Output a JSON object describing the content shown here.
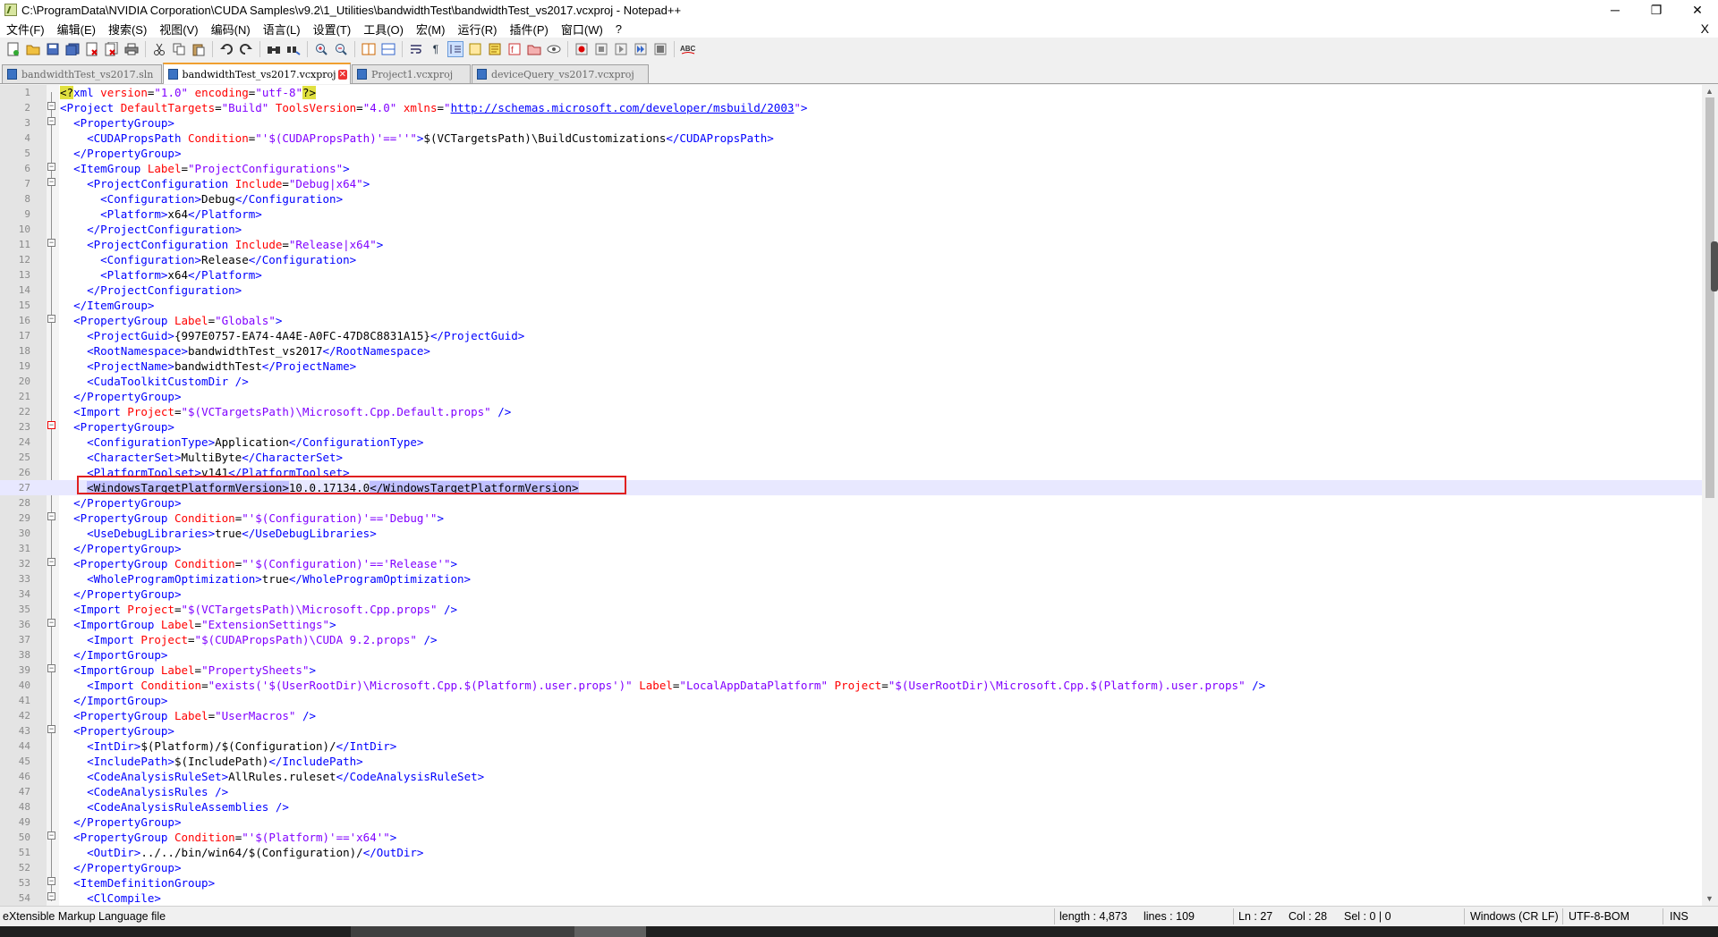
{
  "window": {
    "title": "C:\\ProgramData\\NVIDIA Corporation\\CUDA Samples\\v9.2\\1_Utilities\\bandwidthTest\\bandwidthTest_vs2017.vcxproj - Notepad++",
    "minimize": "─",
    "restore": "❐",
    "close": "✕"
  },
  "menu": {
    "items": [
      "文件(F)",
      "编辑(E)",
      "搜索(S)",
      "视图(V)",
      "编码(N)",
      "语言(L)",
      "设置(T)",
      "工具(O)",
      "宏(M)",
      "运行(R)",
      "插件(P)",
      "窗口(W)",
      "?"
    ],
    "close_doc": "X"
  },
  "toolbar": {
    "icons": [
      "new-file-icon",
      "open-file-icon",
      "save-icon",
      "save-all-icon",
      "close-icon",
      "close-all-icon",
      "print-icon",
      "cut-icon",
      "copy-icon",
      "paste-icon",
      "undo-icon",
      "redo-icon",
      "find-icon",
      "replace-icon",
      "zoom-in-icon",
      "zoom-out-icon",
      "sync-v-icon",
      "sync-h-icon",
      "word-wrap-icon",
      "show-all-chars-icon",
      "indent-guide-icon",
      "udl-icon",
      "doc-map-icon",
      "function-list-icon",
      "folder-workspace-icon",
      "monitor-icon",
      "record-macro-icon",
      "stop-record-icon",
      "play-macro-icon",
      "run-multiple-icon",
      "save-macro-icon",
      "spellcheck-icon"
    ]
  },
  "tabs": [
    {
      "label": "bandwidthTest_vs2017.sln",
      "active": false
    },
    {
      "label": "bandwidthTest_vs2017.vcxproj",
      "active": true
    },
    {
      "label": "Project1.vcxproj",
      "active": false
    },
    {
      "label": "deviceQuery_vs2017.vcxproj",
      "active": false
    }
  ],
  "editor": {
    "caret_line": 27,
    "lines": [
      [
        [
          "hlm",
          "<?"
        ],
        [
          "t",
          "xml "
        ],
        [
          "a",
          "version"
        ],
        [
          "p",
          "="
        ],
        [
          "v",
          "\"1.0\""
        ],
        [
          "p",
          " "
        ],
        [
          "a",
          "encoding"
        ],
        [
          "p",
          "="
        ],
        [
          "v",
          "\"utf-8\""
        ],
        [
          "hlm",
          "?>"
        ]
      ],
      [
        [
          "t",
          "<Project "
        ],
        [
          "a",
          "DefaultTargets"
        ],
        [
          "p",
          "="
        ],
        [
          "v",
          "\"Build\""
        ],
        [
          "p",
          " "
        ],
        [
          "a",
          "ToolsVersion"
        ],
        [
          "p",
          "="
        ],
        [
          "v",
          "\"4.0\""
        ],
        [
          "p",
          " "
        ],
        [
          "a",
          "xmlns"
        ],
        [
          "p",
          "="
        ],
        [
          "v",
          "\""
        ],
        [
          "u",
          "http://schemas.microsoft.com/developer/msbuild/2003"
        ],
        [
          "v",
          "\""
        ],
        [
          "t",
          ">"
        ]
      ],
      [
        [
          "p",
          "  "
        ],
        [
          "t",
          "<PropertyGroup>"
        ]
      ],
      [
        [
          "p",
          "    "
        ],
        [
          "t",
          "<CUDAPropsPath "
        ],
        [
          "a",
          "Condition"
        ],
        [
          "p",
          "="
        ],
        [
          "v",
          "\"'$(CUDAPropsPath)'==''\""
        ],
        [
          "t",
          ">"
        ],
        [
          "p",
          "$(VCTargetsPath)\\BuildCustomizations"
        ],
        [
          "t",
          "</CUDAPropsPath>"
        ]
      ],
      [
        [
          "p",
          "  "
        ],
        [
          "t",
          "</PropertyGroup>"
        ]
      ],
      [
        [
          "p",
          "  "
        ],
        [
          "t",
          "<ItemGroup "
        ],
        [
          "a",
          "Label"
        ],
        [
          "p",
          "="
        ],
        [
          "v",
          "\"ProjectConfigurations\""
        ],
        [
          "t",
          ">"
        ]
      ],
      [
        [
          "p",
          "    "
        ],
        [
          "t",
          "<ProjectConfiguration "
        ],
        [
          "a",
          "Include"
        ],
        [
          "p",
          "="
        ],
        [
          "v",
          "\"Debug|x64\""
        ],
        [
          "t",
          ">"
        ]
      ],
      [
        [
          "p",
          "      "
        ],
        [
          "t",
          "<Configuration>"
        ],
        [
          "p",
          "Debug"
        ],
        [
          "t",
          "</Configuration>"
        ]
      ],
      [
        [
          "p",
          "      "
        ],
        [
          "t",
          "<Platform>"
        ],
        [
          "p",
          "x64"
        ],
        [
          "t",
          "</Platform>"
        ]
      ],
      [
        [
          "p",
          "    "
        ],
        [
          "t",
          "</ProjectConfiguration>"
        ]
      ],
      [
        [
          "p",
          "    "
        ],
        [
          "t",
          "<ProjectConfiguration "
        ],
        [
          "a",
          "Include"
        ],
        [
          "p",
          "="
        ],
        [
          "v",
          "\"Release|x64\""
        ],
        [
          "t",
          ">"
        ]
      ],
      [
        [
          "p",
          "      "
        ],
        [
          "t",
          "<Configuration>"
        ],
        [
          "p",
          "Release"
        ],
        [
          "t",
          "</Configuration>"
        ]
      ],
      [
        [
          "p",
          "      "
        ],
        [
          "t",
          "<Platform>"
        ],
        [
          "p",
          "x64"
        ],
        [
          "t",
          "</Platform>"
        ]
      ],
      [
        [
          "p",
          "    "
        ],
        [
          "t",
          "</ProjectConfiguration>"
        ]
      ],
      [
        [
          "p",
          "  "
        ],
        [
          "t",
          "</ItemGroup>"
        ]
      ],
      [
        [
          "p",
          "  "
        ],
        [
          "t",
          "<PropertyGroup "
        ],
        [
          "a",
          "Label"
        ],
        [
          "p",
          "="
        ],
        [
          "v",
          "\"Globals\""
        ],
        [
          "t",
          ">"
        ]
      ],
      [
        [
          "p",
          "    "
        ],
        [
          "t",
          "<ProjectGuid>"
        ],
        [
          "p",
          "{997E0757-EA74-4A4E-A0FC-47D8C8831A15}"
        ],
        [
          "t",
          "</ProjectGuid>"
        ]
      ],
      [
        [
          "p",
          "    "
        ],
        [
          "t",
          "<RootNamespace>"
        ],
        [
          "p",
          "bandwidthTest_vs2017"
        ],
        [
          "t",
          "</RootNamespace>"
        ]
      ],
      [
        [
          "p",
          "    "
        ],
        [
          "t",
          "<ProjectName>"
        ],
        [
          "p",
          "bandwidthTest"
        ],
        [
          "t",
          "</ProjectName>"
        ]
      ],
      [
        [
          "p",
          "    "
        ],
        [
          "t",
          "<CudaToolkitCustomDir />"
        ]
      ],
      [
        [
          "p",
          "  "
        ],
        [
          "t",
          "</PropertyGroup>"
        ]
      ],
      [
        [
          "p",
          "  "
        ],
        [
          "t",
          "<Import "
        ],
        [
          "a",
          "Project"
        ],
        [
          "p",
          "="
        ],
        [
          "v",
          "\"$(VCTargetsPath)\\Microsoft.Cpp.Default.props\""
        ],
        [
          "p",
          " "
        ],
        [
          "t",
          "/>"
        ]
      ],
      [
        [
          "p",
          "  "
        ],
        [
          "t",
          "<PropertyGroup>"
        ]
      ],
      [
        [
          "p",
          "    "
        ],
        [
          "t",
          "<ConfigurationType>"
        ],
        [
          "p",
          "Application"
        ],
        [
          "t",
          "</ConfigurationType>"
        ]
      ],
      [
        [
          "p",
          "    "
        ],
        [
          "t",
          "<CharacterSet>"
        ],
        [
          "p",
          "MultiByte"
        ],
        [
          "t",
          "</CharacterSet>"
        ]
      ],
      [
        [
          "p",
          "    "
        ],
        [
          "t",
          "<PlatformToolset>"
        ],
        [
          "p",
          "v141"
        ],
        [
          "t",
          "</PlatformToolset>"
        ]
      ],
      [
        [
          "p",
          "    "
        ],
        [
          "sel",
          "<WindowsTargetPlatformVersion>"
        ],
        [
          "p",
          "10.0.17134.0"
        ],
        [
          "sel",
          "</WindowsTargetPlatformVersion>"
        ]
      ],
      [
        [
          "p",
          "  "
        ],
        [
          "t",
          "</PropertyGroup>"
        ]
      ],
      [
        [
          "p",
          "  "
        ],
        [
          "t",
          "<PropertyGroup "
        ],
        [
          "a",
          "Condition"
        ],
        [
          "p",
          "="
        ],
        [
          "v",
          "\"'$(Configuration)'=='Debug'\""
        ],
        [
          "t",
          ">"
        ]
      ],
      [
        [
          "p",
          "    "
        ],
        [
          "t",
          "<UseDebugLibraries>"
        ],
        [
          "p",
          "true"
        ],
        [
          "t",
          "</UseDebugLibraries>"
        ]
      ],
      [
        [
          "p",
          "  "
        ],
        [
          "t",
          "</PropertyGroup>"
        ]
      ],
      [
        [
          "p",
          "  "
        ],
        [
          "t",
          "<PropertyGroup "
        ],
        [
          "a",
          "Condition"
        ],
        [
          "p",
          "="
        ],
        [
          "v",
          "\"'$(Configuration)'=='Release'\""
        ],
        [
          "t",
          ">"
        ]
      ],
      [
        [
          "p",
          "    "
        ],
        [
          "t",
          "<WholeProgramOptimization>"
        ],
        [
          "p",
          "true"
        ],
        [
          "t",
          "</WholeProgramOptimization>"
        ]
      ],
      [
        [
          "p",
          "  "
        ],
        [
          "t",
          "</PropertyGroup>"
        ]
      ],
      [
        [
          "p",
          "  "
        ],
        [
          "t",
          "<Import "
        ],
        [
          "a",
          "Project"
        ],
        [
          "p",
          "="
        ],
        [
          "v",
          "\"$(VCTargetsPath)\\Microsoft.Cpp.props\""
        ],
        [
          "p",
          " "
        ],
        [
          "t",
          "/>"
        ]
      ],
      [
        [
          "p",
          "  "
        ],
        [
          "t",
          "<ImportGroup "
        ],
        [
          "a",
          "Label"
        ],
        [
          "p",
          "="
        ],
        [
          "v",
          "\"ExtensionSettings\""
        ],
        [
          "t",
          ">"
        ]
      ],
      [
        [
          "p",
          "    "
        ],
        [
          "t",
          "<Import "
        ],
        [
          "a",
          "Project"
        ],
        [
          "p",
          "="
        ],
        [
          "v",
          "\"$(CUDAPropsPath)\\CUDA 9.2.props\""
        ],
        [
          "p",
          " "
        ],
        [
          "t",
          "/>"
        ]
      ],
      [
        [
          "p",
          "  "
        ],
        [
          "t",
          "</ImportGroup>"
        ]
      ],
      [
        [
          "p",
          "  "
        ],
        [
          "t",
          "<ImportGroup "
        ],
        [
          "a",
          "Label"
        ],
        [
          "p",
          "="
        ],
        [
          "v",
          "\"PropertySheets\""
        ],
        [
          "t",
          ">"
        ]
      ],
      [
        [
          "p",
          "    "
        ],
        [
          "t",
          "<Import "
        ],
        [
          "a",
          "Condition"
        ],
        [
          "p",
          "="
        ],
        [
          "v",
          "\"exists('$(UserRootDir)\\Microsoft.Cpp.$(Platform).user.props')\""
        ],
        [
          "p",
          " "
        ],
        [
          "a",
          "Label"
        ],
        [
          "p",
          "="
        ],
        [
          "v",
          "\"LocalAppDataPlatform\""
        ],
        [
          "p",
          " "
        ],
        [
          "a",
          "Project"
        ],
        [
          "p",
          "="
        ],
        [
          "v",
          "\"$(UserRootDir)\\Microsoft.Cpp.$(Platform).user.props\""
        ],
        [
          "p",
          " "
        ],
        [
          "t",
          "/>"
        ]
      ],
      [
        [
          "p",
          "  "
        ],
        [
          "t",
          "</ImportGroup>"
        ]
      ],
      [
        [
          "p",
          "  "
        ],
        [
          "t",
          "<PropertyGroup "
        ],
        [
          "a",
          "Label"
        ],
        [
          "p",
          "="
        ],
        [
          "v",
          "\"UserMacros\""
        ],
        [
          "p",
          " "
        ],
        [
          "t",
          "/>"
        ]
      ],
      [
        [
          "p",
          "  "
        ],
        [
          "t",
          "<PropertyGroup>"
        ]
      ],
      [
        [
          "p",
          "    "
        ],
        [
          "t",
          "<IntDir>"
        ],
        [
          "p",
          "$(Platform)/$(Configuration)/"
        ],
        [
          "t",
          "</IntDir>"
        ]
      ],
      [
        [
          "p",
          "    "
        ],
        [
          "t",
          "<IncludePath>"
        ],
        [
          "p",
          "$(IncludePath)"
        ],
        [
          "t",
          "</IncludePath>"
        ]
      ],
      [
        [
          "p",
          "    "
        ],
        [
          "t",
          "<CodeAnalysisRuleSet>"
        ],
        [
          "p",
          "AllRules.ruleset"
        ],
        [
          "t",
          "</CodeAnalysisRuleSet>"
        ]
      ],
      [
        [
          "p",
          "    "
        ],
        [
          "t",
          "<CodeAnalysisRules />"
        ]
      ],
      [
        [
          "p",
          "    "
        ],
        [
          "t",
          "<CodeAnalysisRuleAssemblies />"
        ]
      ],
      [
        [
          "p",
          "  "
        ],
        [
          "t",
          "</PropertyGroup>"
        ]
      ],
      [
        [
          "p",
          "  "
        ],
        [
          "t",
          "<PropertyGroup "
        ],
        [
          "a",
          "Condition"
        ],
        [
          "p",
          "="
        ],
        [
          "v",
          "\"'$(Platform)'=='x64'\""
        ],
        [
          "t",
          ">"
        ]
      ],
      [
        [
          "p",
          "    "
        ],
        [
          "t",
          "<OutDir>"
        ],
        [
          "p",
          "../../bin/win64/$(Configuration)/"
        ],
        [
          "t",
          "</OutDir>"
        ]
      ],
      [
        [
          "p",
          "  "
        ],
        [
          "t",
          "</PropertyGroup>"
        ]
      ],
      [
        [
          "p",
          "  "
        ],
        [
          "t",
          "<ItemDefinitionGroup>"
        ]
      ],
      [
        [
          "p",
          "    "
        ],
        [
          "t",
          "<ClCompile>"
        ]
      ]
    ],
    "folds": {
      "2": "minus",
      "3": "minus",
      "6": "minus",
      "7": "minus",
      "11": "minus",
      "16": "minus",
      "23": "minus-red",
      "29": "minus",
      "32": "minus",
      "36": "minus",
      "39": "minus",
      "43": "minus",
      "50": "minus",
      "53": "minus",
      "54": "minus"
    }
  },
  "status": {
    "file_type": "eXtensible Markup Language file",
    "length": "length : 4,873",
    "lines": "lines : 109",
    "ln": "Ln : 27",
    "col": "Col : 28",
    "sel": "Sel : 0 | 0",
    "eol": "Windows (CR LF)",
    "encoding": "UTF-8-BOM",
    "mode": "INS"
  }
}
